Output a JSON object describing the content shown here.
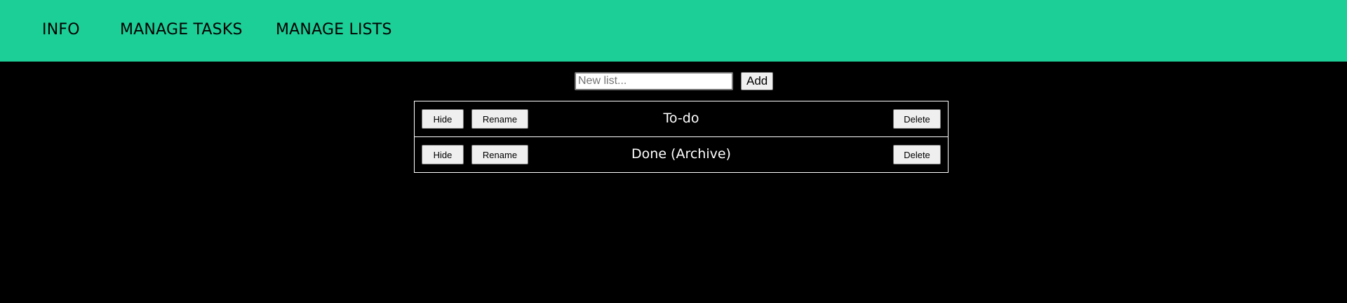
{
  "nav": {
    "items": [
      {
        "label": "INFO"
      },
      {
        "label": "MANAGE TASKS"
      },
      {
        "label": "MANAGE LISTS"
      }
    ]
  },
  "add_list": {
    "placeholder": "New list...",
    "value": "",
    "button_label": "Add"
  },
  "lists": [
    {
      "name": "To-do",
      "hide_label": "Hide",
      "rename_label": "Rename",
      "delete_label": "Delete"
    },
    {
      "name": "Done (Archive)",
      "hide_label": "Hide",
      "rename_label": "Rename",
      "delete_label": "Delete"
    }
  ],
  "colors": {
    "nav_background": "#1ccf97",
    "page_background": "#000000",
    "row_border": "#ffffff",
    "list_text": "#ffffff"
  }
}
